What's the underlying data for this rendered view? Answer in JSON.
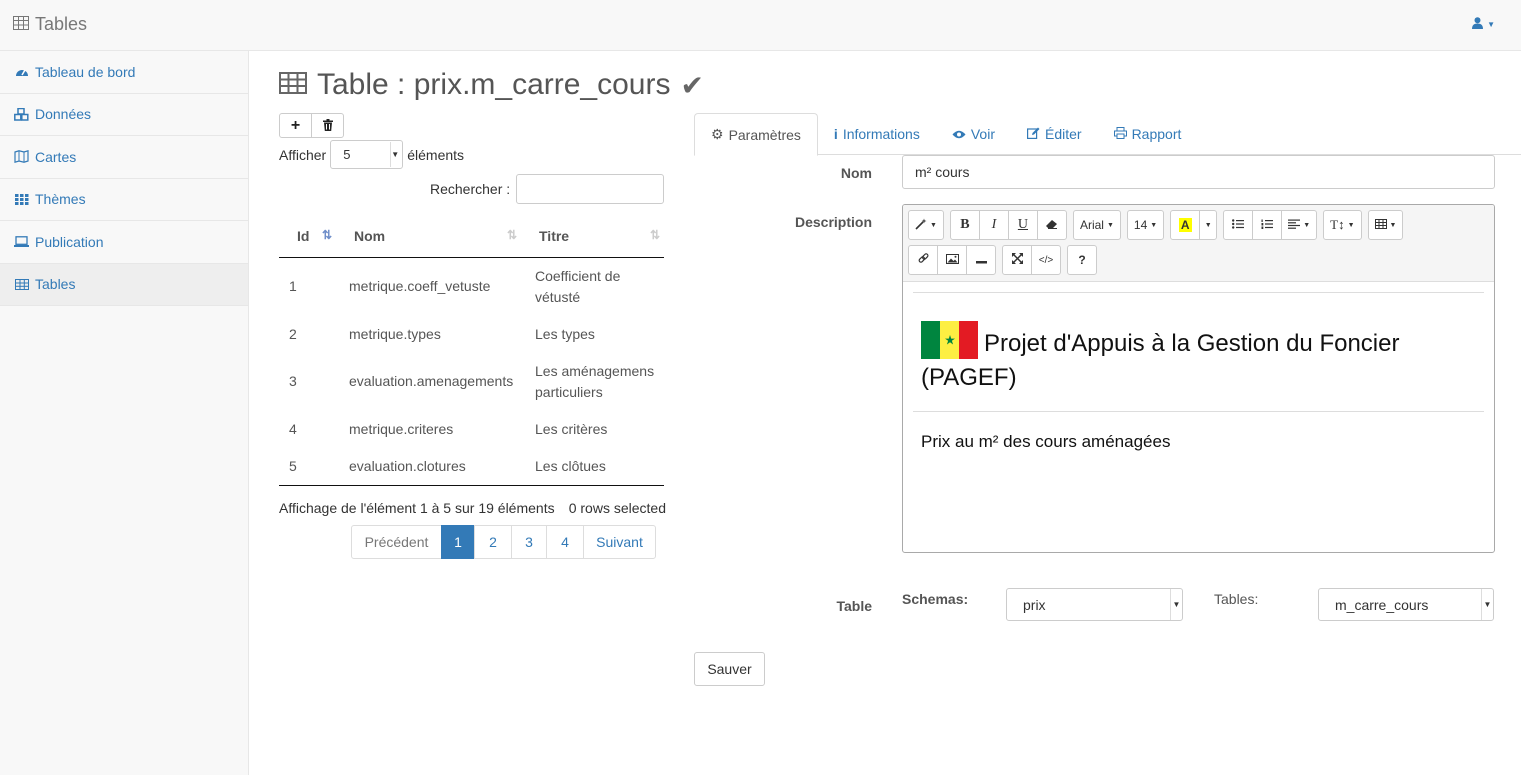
{
  "app": {
    "title": "Tables"
  },
  "sidebar": {
    "items": [
      {
        "label": "Tableau de bord",
        "icon": "dashboard-icon"
      },
      {
        "label": "Données",
        "icon": "cubes-icon"
      },
      {
        "label": "Cartes",
        "icon": "map-icon"
      },
      {
        "label": "Thèmes",
        "icon": "grid-icon"
      },
      {
        "label": "Publication",
        "icon": "laptop-icon"
      },
      {
        "label": "Tables",
        "icon": "table-icon"
      }
    ]
  },
  "page": {
    "title": "Table : prix.m_carre_cours",
    "status_icon": "check-icon"
  },
  "list": {
    "show_label": "Afficher",
    "page_length": "5",
    "elements_label": "éléments",
    "search_label": "Rechercher :",
    "search_value": "",
    "columns": [
      "Id",
      "Nom",
      "Titre"
    ],
    "rows": [
      {
        "id": "1",
        "nom": "metrique.coeff_vetuste",
        "titre": "Coefficient de vétusté"
      },
      {
        "id": "2",
        "nom": "metrique.types",
        "titre": "Les types"
      },
      {
        "id": "3",
        "nom": "evaluation.amenagements",
        "titre": "Les aménagemens particuliers"
      },
      {
        "id": "4",
        "nom": "metrique.criteres",
        "titre": "Les critères"
      },
      {
        "id": "5",
        "nom": "evaluation.clotures",
        "titre": "Les clôtues"
      }
    ],
    "info": "Affichage de l'élément 1 à 5 sur 19 éléments",
    "selected_info": "0 rows selected",
    "pager": {
      "prev": "Précédent",
      "pages": [
        "1",
        "2",
        "3",
        "4"
      ],
      "active_page": "1",
      "next": "Suivant"
    }
  },
  "tabs": [
    {
      "label": "Paramètres",
      "icon": "gear-icon"
    },
    {
      "label": "Informations",
      "icon": "info-icon"
    },
    {
      "label": "Voir",
      "icon": "eye-icon"
    },
    {
      "label": "Éditer",
      "icon": "edit-icon"
    },
    {
      "label": "Rapport",
      "icon": "print-icon"
    }
  ],
  "form": {
    "nom_label": "Nom",
    "nom_value": "m² cours",
    "description_label": "Description",
    "editor": {
      "font_name": "Arial",
      "font_size": "14",
      "color_letter": "A",
      "help": "?",
      "heading": "Projet d'Appuis à la Gestion du Foncier (PAGEF)",
      "body": "Prix au m² des cours aménagées"
    },
    "table_label": "Table",
    "schemas_label": "Schemas:",
    "schemas_value": "prix",
    "tables_label": "Tables:",
    "tables_value": "m_carre_cours",
    "save_label": "Sauver"
  }
}
